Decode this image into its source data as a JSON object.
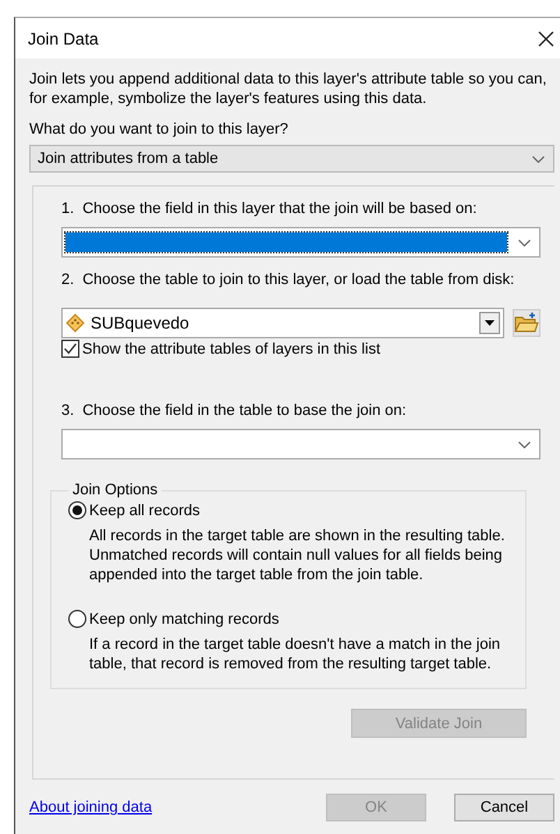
{
  "window": {
    "title": "Join Data"
  },
  "intro": "Join lets you append additional data to this layer's attribute table so you can, for example, symbolize the layer's features using this data.",
  "question": "What do you want to join to this layer?",
  "join_type": {
    "value": "Join attributes from a table"
  },
  "steps": [
    {
      "number": "1.",
      "label": "Choose the field in this layer that the join will be based on:",
      "kind": "field",
      "highlighted": true
    },
    {
      "number": "2.",
      "label": "Choose the table to join to this layer, or load the table from disk:",
      "kind": "table",
      "value": "SUBquevedo",
      "checkbox": {
        "label": "Show the attribute tables of layers in this list",
        "checked": true
      }
    },
    {
      "number": "3.",
      "label": "Choose the field in the table to base the join on:",
      "kind": "field",
      "highlighted": false
    }
  ],
  "join_options": {
    "title": "Join Options",
    "options": [
      {
        "label": "Keep all records",
        "description": "All records in the target table are shown in the resulting table. Unmatched records will contain null values for all fields being appended into the target table from the join table.",
        "selected": true
      },
      {
        "label": "Keep only matching records",
        "description": "If a record in the target table doesn't have a match in the join table, that record is removed from the resulting target table.",
        "selected": false
      }
    ]
  },
  "validate_button": {
    "label": "Validate Join",
    "disabled": true
  },
  "help_link": "About joining data",
  "buttons": [
    {
      "label": "OK",
      "disabled": true
    },
    {
      "label": "Cancel",
      "disabled": false
    }
  ]
}
